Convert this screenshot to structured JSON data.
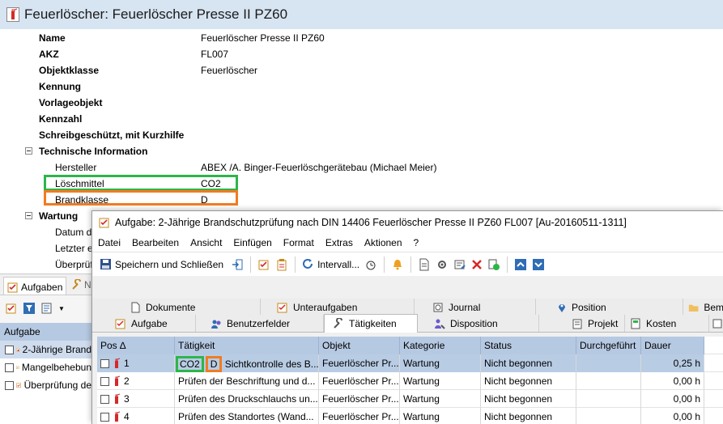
{
  "window": {
    "title": "Feuerlöscher: Feuerlöscher Presse  II PZ60"
  },
  "properties": [
    {
      "key": "Name",
      "value": "Feuerlöscher Presse  II PZ60",
      "bold": true
    },
    {
      "key": "AKZ",
      "value": "FL007",
      "bold": true
    },
    {
      "key": "Objektklasse",
      "value": "Feuerlöscher",
      "bold": true
    },
    {
      "key": "Kennung",
      "value": "",
      "bold": true
    },
    {
      "key": "Vorlageobjekt",
      "value": "",
      "bold": true
    },
    {
      "key": "Kennzahl",
      "value": "",
      "bold": true
    },
    {
      "key": "Schreibgeschützt, mit Kurzhilfe",
      "value": "",
      "bold": true
    }
  ],
  "technical": {
    "group_label": "Technische Information",
    "rows": [
      {
        "key": "Hersteller",
        "value": "ABEX /A. Binger-Feuerlöschgerätebau  (Michael Meier)"
      },
      {
        "key": "Löschmittel",
        "value": "CO2"
      },
      {
        "key": "Brandklasse",
        "value": "D"
      }
    ]
  },
  "wartung": {
    "group_label": "Wartung",
    "rows": [
      "Datum d",
      "Letzter e",
      "Überprüf"
    ]
  },
  "left_panel": {
    "tab_label": "Aufgaben",
    "tab_other": "N",
    "list_header": "Aufgabe",
    "items": [
      "2-Jährige Brand",
      "Mangelbehebun",
      "Überprüfung de"
    ]
  },
  "dialog": {
    "title": "Aufgabe: 2-Jährige Brandschutzprüfung nach DIN 14406 Feuerlöscher Presse  II PZ60 FL007 [Au-20160511-1311]",
    "menu": [
      "Datei",
      "Bearbeiten",
      "Ansicht",
      "Einfügen",
      "Format",
      "Extras",
      "Aktionen",
      "?"
    ],
    "toolbar": {
      "save_close": "Speichern und Schließen",
      "intervall": "Intervall..."
    },
    "tabs_row1": [
      "Dokumente",
      "Unteraufgaben",
      "Journal",
      "Position",
      "Bem"
    ],
    "tabs_row2": [
      "Aufgabe",
      "Benutzerfelder",
      "Tätigkeiten",
      "Disposition",
      "Projekt",
      "Kosten"
    ],
    "active_tab": "Tätigkeiten"
  },
  "grid": {
    "columns": [
      "Pos ∆",
      "Tätigkeit",
      "Objekt",
      "Kategorie",
      "Status",
      "Durchgeführt",
      "Dauer"
    ],
    "rows": [
      {
        "pos": "1",
        "tag1": "CO2",
        "tag2": "D",
        "taetigkeit": "Sichtkontrolle des B...",
        "objekt": "Feuerlöscher Pr...",
        "kategorie": "Wartung",
        "status": "Nicht begonnen",
        "durchgefuehrt": "",
        "dauer": "0,25 h"
      },
      {
        "pos": "2",
        "tag1": "",
        "tag2": "",
        "taetigkeit": "Prüfen der Beschriftung und d...",
        "objekt": "Feuerlöscher Pr...",
        "kategorie": "Wartung",
        "status": "Nicht begonnen",
        "durchgefuehrt": "",
        "dauer": "0,00 h"
      },
      {
        "pos": "3",
        "tag1": "",
        "tag2": "",
        "taetigkeit": "Prüfen des Druckschlauchs un...",
        "objekt": "Feuerlöscher Pr...",
        "kategorie": "Wartung",
        "status": "Nicht begonnen",
        "durchgefuehrt": "",
        "dauer": "0,00 h"
      },
      {
        "pos": "4",
        "tag1": "",
        "tag2": "",
        "taetigkeit": "Prüfen des Standortes (Wand...",
        "objekt": "Feuerlöscher Pr...",
        "kategorie": "Wartung",
        "status": "Nicht begonnen",
        "durchgefuehrt": "",
        "dauer": "0,00 h"
      }
    ]
  },
  "colors": {
    "highlight_green": "#2db54a",
    "highlight_orange": "#f07c22",
    "header_blue": "#b6c9e2"
  }
}
